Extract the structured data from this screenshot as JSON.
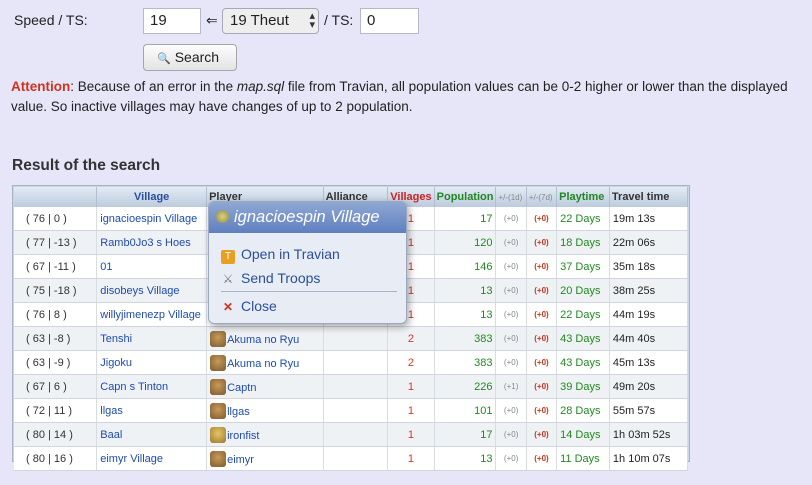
{
  "form": {
    "speed_label": "Speed / TS:",
    "speed_value": "19",
    "arrow": "⇐",
    "select_value": "19 Theut",
    "ts_label": "/ TS:",
    "ts_value": "0",
    "search_label": "Search"
  },
  "attention": {
    "label": "Attention",
    "text1": ": Because of an error in the ",
    "file": "map.sql",
    "text2": " file from Travian, all population values can be 0-2 higher or lower than the displayed value. So inactive villages may have changes of up to 2 population."
  },
  "result_title": "Result of the search",
  "table": {
    "headers": {
      "village": "Village",
      "player": "Player",
      "alliance": "Alliance",
      "villages": "Villages",
      "population": "Population",
      "d1": "+/-(1d)",
      "d7": "+/-(7d)",
      "playtime": "Playtime",
      "travel": "Travel time"
    },
    "rows": [
      {
        "coord": "( 76 | 0 )",
        "village": "ignacioespin Village",
        "player": "",
        "villages": "1",
        "pop": "17",
        "d1": "(+0)",
        "d7": "(+0)",
        "playtime": "22 Days",
        "travel": "19m 13s"
      },
      {
        "coord": "( 77 | -13 )",
        "village": "Ramb0Jo3 s Hoes",
        "player": "",
        "villages": "1",
        "pop": "120",
        "d1": "(+0)",
        "d7": "(+0)",
        "playtime": "18 Days",
        "travel": "22m 06s"
      },
      {
        "coord": "( 67 | -11 )",
        "village": "01",
        "player": "",
        "villages": "1",
        "pop": "146",
        "d1": "(+0)",
        "d7": "(+0)",
        "playtime": "37 Days",
        "travel": "35m 18s"
      },
      {
        "coord": "( 75 | -18 )",
        "village": "disobeys Village",
        "player": "",
        "villages": "1",
        "pop": "13",
        "d1": "(+0)",
        "d7": "(+0)",
        "playtime": "20 Days",
        "travel": "38m 25s"
      },
      {
        "coord": "( 76 | 8 )",
        "village": "willyjimenezp Village",
        "player": "",
        "villages": "1",
        "pop": "13",
        "d1": "(+0)",
        "d7": "(+0)",
        "playtime": "22 Days",
        "travel": "44m 19s"
      },
      {
        "coord": "( 63 | -8 )",
        "village": "Tenshi",
        "player": "Akuma no Ryu",
        "villages": "2",
        "pop": "383",
        "d1": "(+0)",
        "d7": "(+0)",
        "playtime": "43 Days",
        "travel": "44m 40s"
      },
      {
        "coord": "( 63 | -9 )",
        "village": "Jigoku",
        "player": "Akuma no Ryu",
        "villages": "2",
        "pop": "383",
        "d1": "(+0)",
        "d7": "(+0)",
        "playtime": "43 Days",
        "travel": "45m 13s"
      },
      {
        "coord": "( 67 | 6 )",
        "village": "Capn s Tinton",
        "player": "Captn",
        "villages": "1",
        "pop": "226",
        "d1": "(+1)",
        "d7": "(+0)",
        "playtime": "39 Days",
        "travel": "49m 20s"
      },
      {
        "coord": "( 72 | 11 )",
        "village": "llgas",
        "player": "llgas",
        "villages": "1",
        "pop": "101",
        "d1": "(+0)",
        "d7": "(+0)",
        "playtime": "28 Days",
        "travel": "55m 57s"
      },
      {
        "coord": "( 80 | 14 )",
        "village": "Baal",
        "player": "ironfist",
        "villages": "1",
        "pop": "17",
        "d1": "(+0)",
        "d7": "(+0)",
        "playtime": "14 Days",
        "travel": "1h 03m 52s"
      },
      {
        "coord": "( 80 | 16 )",
        "village": "eimyr Village",
        "player": "eimyr",
        "villages": "1",
        "pop": "13",
        "d1": "(+0)",
        "d7": "(+0)",
        "playtime": "11 Days",
        "travel": "1h 10m 07s"
      }
    ]
  },
  "popup": {
    "title": "ignacioespin Village",
    "open_label": "Open in Travian",
    "troops_label": "Send Troops",
    "close_label": "Close"
  }
}
